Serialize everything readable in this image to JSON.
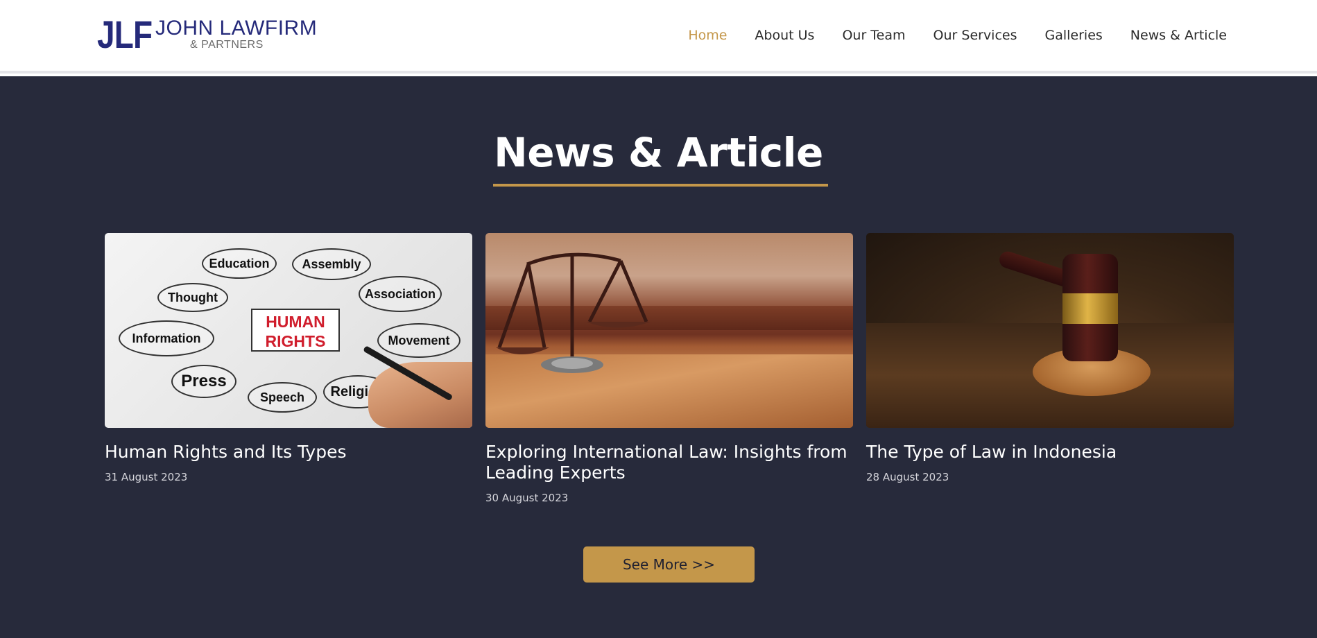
{
  "header": {
    "logo": {
      "mark": "JLF",
      "name": "JOHN LAWFIRM",
      "sub": "& PARTNERS"
    },
    "nav": [
      {
        "label": "Home",
        "active": true
      },
      {
        "label": "About Us"
      },
      {
        "label": "Our Team"
      },
      {
        "label": "Our Services"
      },
      {
        "label": "Galleries"
      },
      {
        "label": "News & Article"
      }
    ]
  },
  "section": {
    "heading": "News & Article",
    "articles": [
      {
        "title": "Human Rights and Its Types",
        "date": "31 August 2023",
        "image": {
          "center_label_1": "HUMAN",
          "center_label_2": "RIGHTS",
          "bubbles": [
            "Education",
            "Assembly",
            "Thought",
            "Association",
            "Information",
            "Movement",
            "Press",
            "Speech",
            "Religion"
          ]
        }
      },
      {
        "title": "Exploring International Law: Insights from Leading Experts",
        "date": "30 August 2023"
      },
      {
        "title": "The Type of Law in Indonesia",
        "date": "28 August 2023"
      }
    ],
    "see_more": "See More >>"
  },
  "colors": {
    "brand_blue": "#252a7a",
    "accent_gold": "#c4974a",
    "section_bg": "#272a3b"
  }
}
